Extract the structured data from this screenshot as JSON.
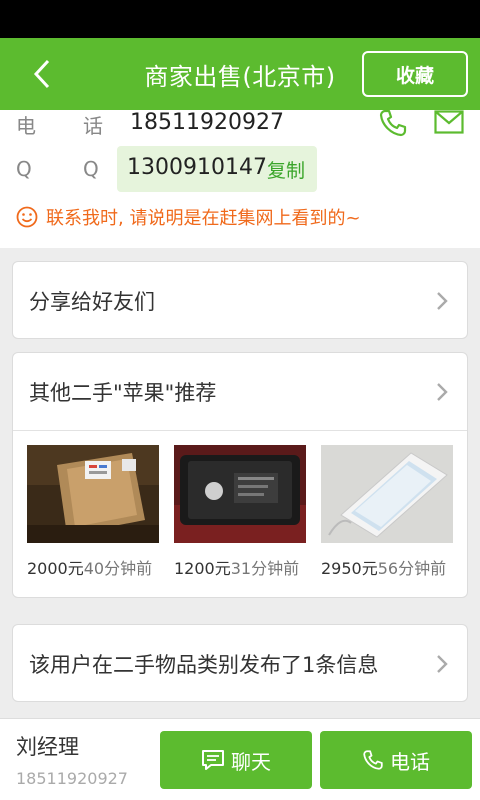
{
  "header": {
    "title": "商家出售(北京市)",
    "favorite_label": "收藏"
  },
  "contact": {
    "phone_label_1": "电",
    "phone_label_2": "话",
    "phone_value": "18511920927",
    "qq_label_1": "Q",
    "qq_label_2": "Q",
    "qq_value": "1300910147",
    "copy_label": "复制",
    "notice": "联系我时, 请说明是在赶集网上看到的~"
  },
  "share": {
    "label": "分享给好友们"
  },
  "recommend": {
    "title": "其他二手\"苹果\"推荐",
    "items": [
      {
        "price": "2000元",
        "ago": "40分钟前",
        "thumb": "box-photo"
      },
      {
        "price": "1200元",
        "ago": "31分钟前",
        "thumb": "phone-back-photo"
      },
      {
        "price": "2950元",
        "ago": "56分钟前",
        "thumb": "white-iphone-photo"
      }
    ]
  },
  "user_posts": {
    "label": "该用户在二手物品类别发布了1条信息"
  },
  "seller": {
    "name": "刘经理",
    "phone": "18511920927",
    "chat_label": "聊天",
    "call_label": "电话"
  },
  "colors": {
    "brand_green": "#5cbb2f",
    "notice_orange": "#f06a1c",
    "copy_green": "#3aa52a"
  }
}
